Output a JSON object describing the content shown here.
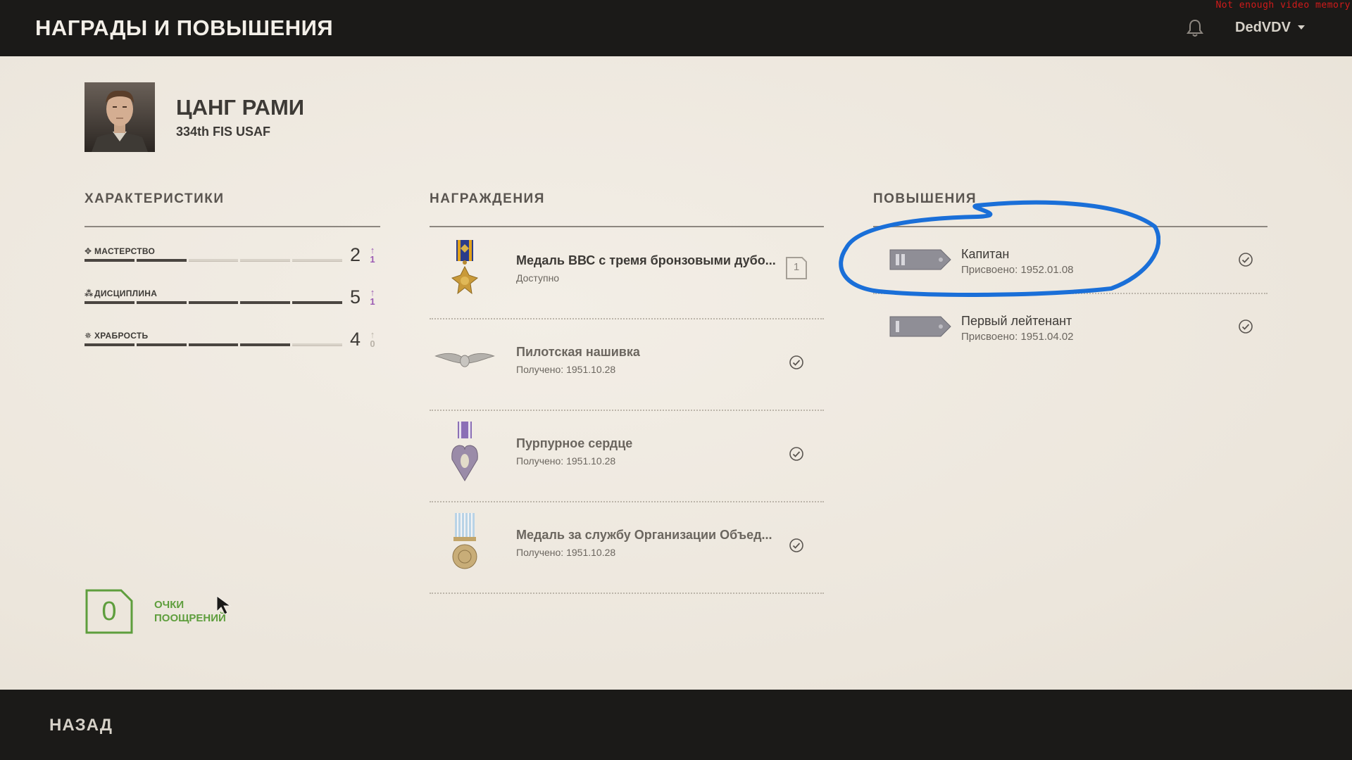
{
  "header": {
    "title": "НАГРАДЫ И ПОВЫШЕНИЯ",
    "username": "DedVDV",
    "warning": "Not enough video memory"
  },
  "pilot": {
    "name": "ЦАНГ РАМИ",
    "unit": "334th FIS USAF"
  },
  "characteristics": {
    "title": "ХАРАКТЕРИСТИКИ",
    "items": [
      {
        "label": "МАСТЕРСТВО",
        "icon": "mastery-icon",
        "value": "2",
        "segments_filled": 2,
        "segments_total": 5,
        "upgrade": "1",
        "upgrade_available": true
      },
      {
        "label": "ДИСЦИПЛИНА",
        "icon": "discipline-icon",
        "value": "5",
        "segments_filled": 5,
        "segments_total": 5,
        "upgrade": "1",
        "upgrade_available": true
      },
      {
        "label": "ХРАБРОСТЬ",
        "icon": "bravery-icon",
        "value": "4",
        "segments_filled": 4,
        "segments_total": 5,
        "upgrade": "0",
        "upgrade_available": false
      }
    ],
    "points": {
      "value": "0",
      "label_line1": "ОЧКИ",
      "label_line2": "ПООЩРЕНИЙ"
    }
  },
  "awards": {
    "title": "НАГРАЖДЕНИЯ",
    "items": [
      {
        "name": "Медаль ВВС с тремя бронзовыми дубо...",
        "status": "Доступно",
        "badge": "1",
        "icon": "air-medal-icon"
      },
      {
        "name": "Пилотская нашивка",
        "status": "Получено: 1951.10.28",
        "icon": "pilot-wings-icon"
      },
      {
        "name": "Пурпурное сердце",
        "status": "Получено: 1951.10.28",
        "icon": "purple-heart-icon"
      },
      {
        "name": "Медаль за службу Организации Объед...",
        "status": "Получено: 1951.10.28",
        "icon": "un-service-medal-icon"
      }
    ]
  },
  "promotions": {
    "title": "ПОВЫШЕНИЯ",
    "items": [
      {
        "name": "Капитан",
        "status": "Присвоено: 1952.01.08",
        "bars": 2,
        "icon": "captain-rank-icon"
      },
      {
        "name": "Первый лейтенант",
        "status": "Присвоено: 1951.04.02",
        "bars": 1,
        "icon": "first-lieutenant-rank-icon"
      }
    ]
  },
  "footer": {
    "back_label": "НАЗАД"
  },
  "colors": {
    "accent_green": "#5e9e3d",
    "upgrade_purple": "#9b5ab3",
    "annotation_blue": "#1a6fd8",
    "warning_red": "#d11a1a"
  }
}
